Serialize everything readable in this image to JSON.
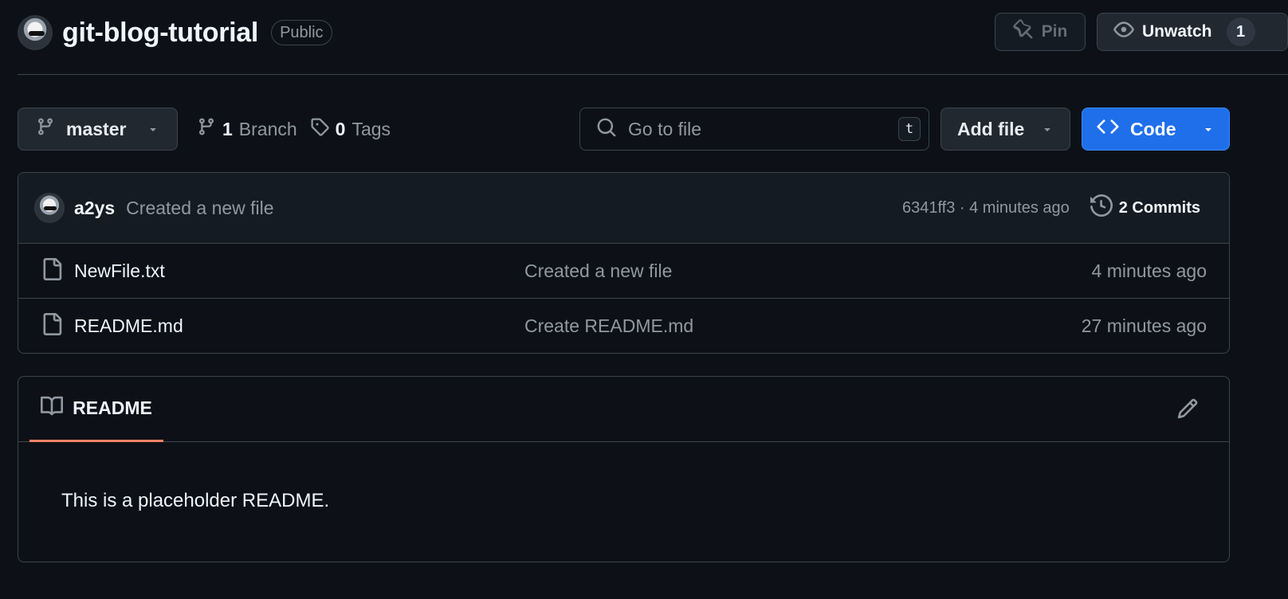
{
  "repo": {
    "name": "git-blog-tutorial",
    "visibility": "Public"
  },
  "header_actions": {
    "pin_label": "Pin",
    "unwatch_label": "Unwatch",
    "watch_count": "1"
  },
  "toolbar": {
    "branch": "master",
    "branch_count": "1",
    "branch_label": "Branch",
    "tag_count": "0",
    "tag_label": "Tags",
    "search_placeholder": "Go to file",
    "search_shortcut": "t",
    "add_file_label": "Add file",
    "code_label": "Code"
  },
  "latest_commit": {
    "author": "a2ys",
    "message": "Created a new file",
    "meta": "6341ff3 · 4 minutes ago",
    "commits_label": "2 Commits"
  },
  "files": [
    {
      "name": "NewFile.txt",
      "commit": "Created a new file",
      "age": "4 minutes ago"
    },
    {
      "name": "README.md",
      "commit": "Create README.md",
      "age": "27 minutes ago"
    }
  ],
  "readme": {
    "tab_label": "README",
    "content": "This is a placeholder README."
  },
  "colors": {
    "background": "#0d1117",
    "border": "#3d444d",
    "primary_button": "#1f6feb",
    "tab_underline": "#f78166"
  },
  "icons": [
    "pin-icon",
    "eye-icon",
    "branch-icon",
    "tag-icon",
    "search-icon",
    "code-icon",
    "history-icon",
    "file-icon",
    "book-icon",
    "pencil-icon",
    "caret-down-icon"
  ]
}
